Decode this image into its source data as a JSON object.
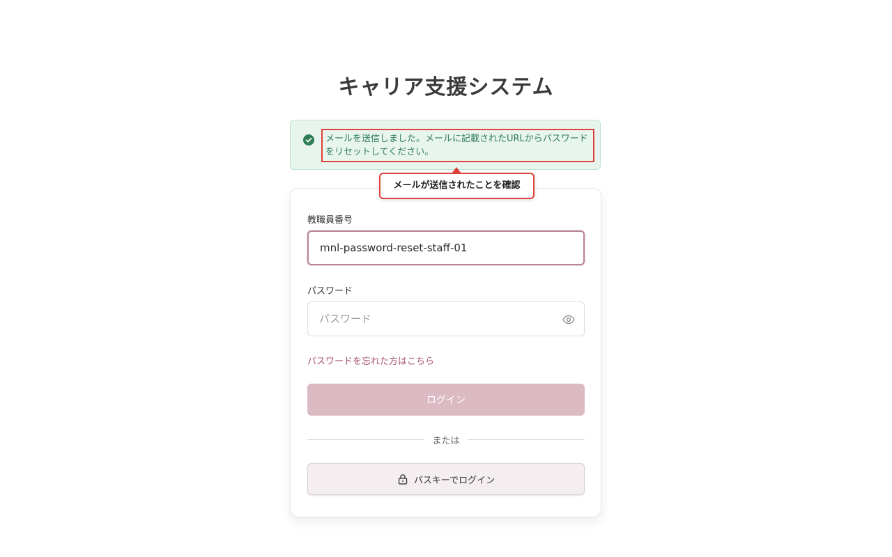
{
  "app": {
    "title": "キャリア支援システム"
  },
  "alert": {
    "message": "メールを送信しました。メールに記載されたURLからパスワードをリセットしてください。",
    "icon": "check-circle-icon",
    "color": "#2f7d57"
  },
  "tooltip": {
    "text": "メールが送信されたことを確認"
  },
  "form": {
    "staff_id": {
      "label": "教職員番号",
      "value": "mnl-password-reset-staff-01"
    },
    "password": {
      "label": "パスワード",
      "placeholder": "パスワード",
      "value": "",
      "toggle_icon": "eye-icon"
    },
    "forgot_link": "パスワードを忘れた方はこちら",
    "login_button": "ログイン",
    "divider_text": "または",
    "passkey_button": "パスキーでログイン",
    "passkey_icon": "lock-icon"
  },
  "colors": {
    "accent": "#a8556f",
    "login_button_bg": "#dcbac3",
    "highlight_border": "#e0413a",
    "alert_bg": "#e8f5ee"
  }
}
